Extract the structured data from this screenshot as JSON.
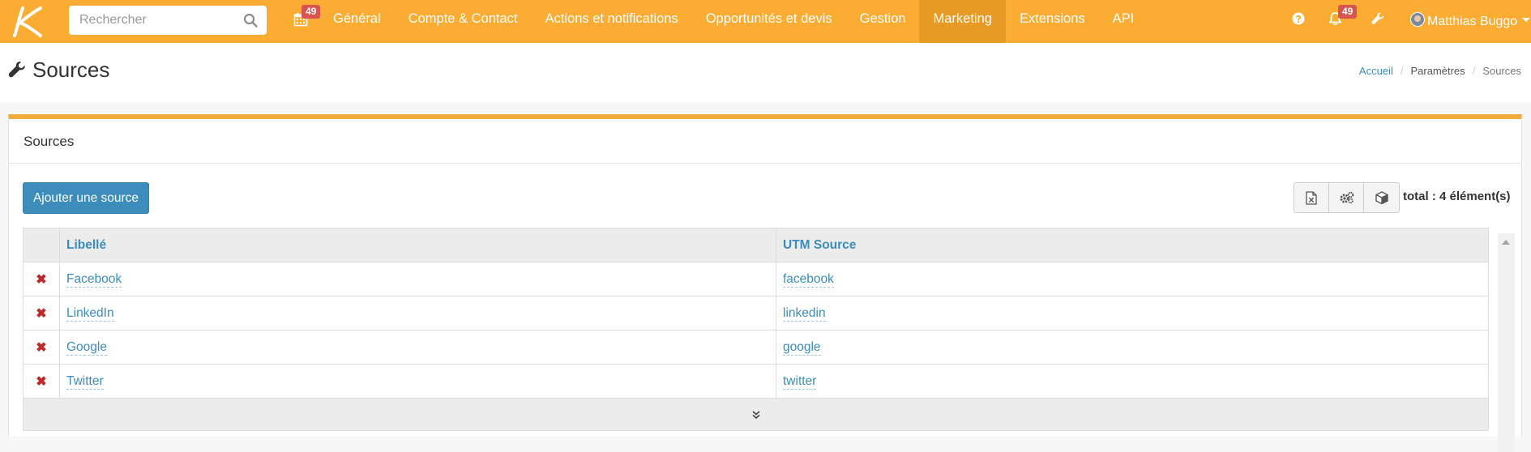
{
  "navbar": {
    "search_placeholder": "Rechercher",
    "calendar_badge": "49",
    "menu": [
      {
        "label": "Général"
      },
      {
        "label": "Compte & Contact"
      },
      {
        "label": "Actions et notifications"
      },
      {
        "label": "Opportunités et devis"
      },
      {
        "label": "Gestion"
      },
      {
        "label": "Marketing",
        "active": true
      },
      {
        "label": "Extensions"
      },
      {
        "label": "API"
      }
    ],
    "notifications_badge": "49",
    "user_name": "Matthias Buggo"
  },
  "page": {
    "title": "Sources",
    "breadcrumb": {
      "home": "Accueil",
      "parent": "Paramètres",
      "current": "Sources"
    }
  },
  "panel": {
    "title": "Sources",
    "add_button": "Ajouter une source",
    "total": "total : 4 élément(s)",
    "table": {
      "columns": {
        "label": "Libellé",
        "utm": "UTM Source"
      },
      "rows": [
        {
          "label": "Facebook",
          "utm": "facebook"
        },
        {
          "label": "LinkedIn",
          "utm": "linkedin"
        },
        {
          "label": "Google",
          "utm": "google"
        },
        {
          "label": "Twitter",
          "utm": "twitter"
        }
      ]
    }
  },
  "colors": {
    "navbar": "#fbad33",
    "navbar_active": "#e89b24",
    "primary": "#3c8dbc",
    "badge": "#d9534f",
    "delete": "#c0282c"
  },
  "icons": {
    "logo": "k-logo",
    "search": "search-icon",
    "calendar": "calendar-icon",
    "help": "question-circle-icon",
    "notifications": "bell-icon",
    "settings": "wrench-icon",
    "export": "excel-file-icon",
    "configure": "gears-icon",
    "package": "cube-icon",
    "delete": "delete-x-icon",
    "expand": "double-chevron-down-icon"
  }
}
